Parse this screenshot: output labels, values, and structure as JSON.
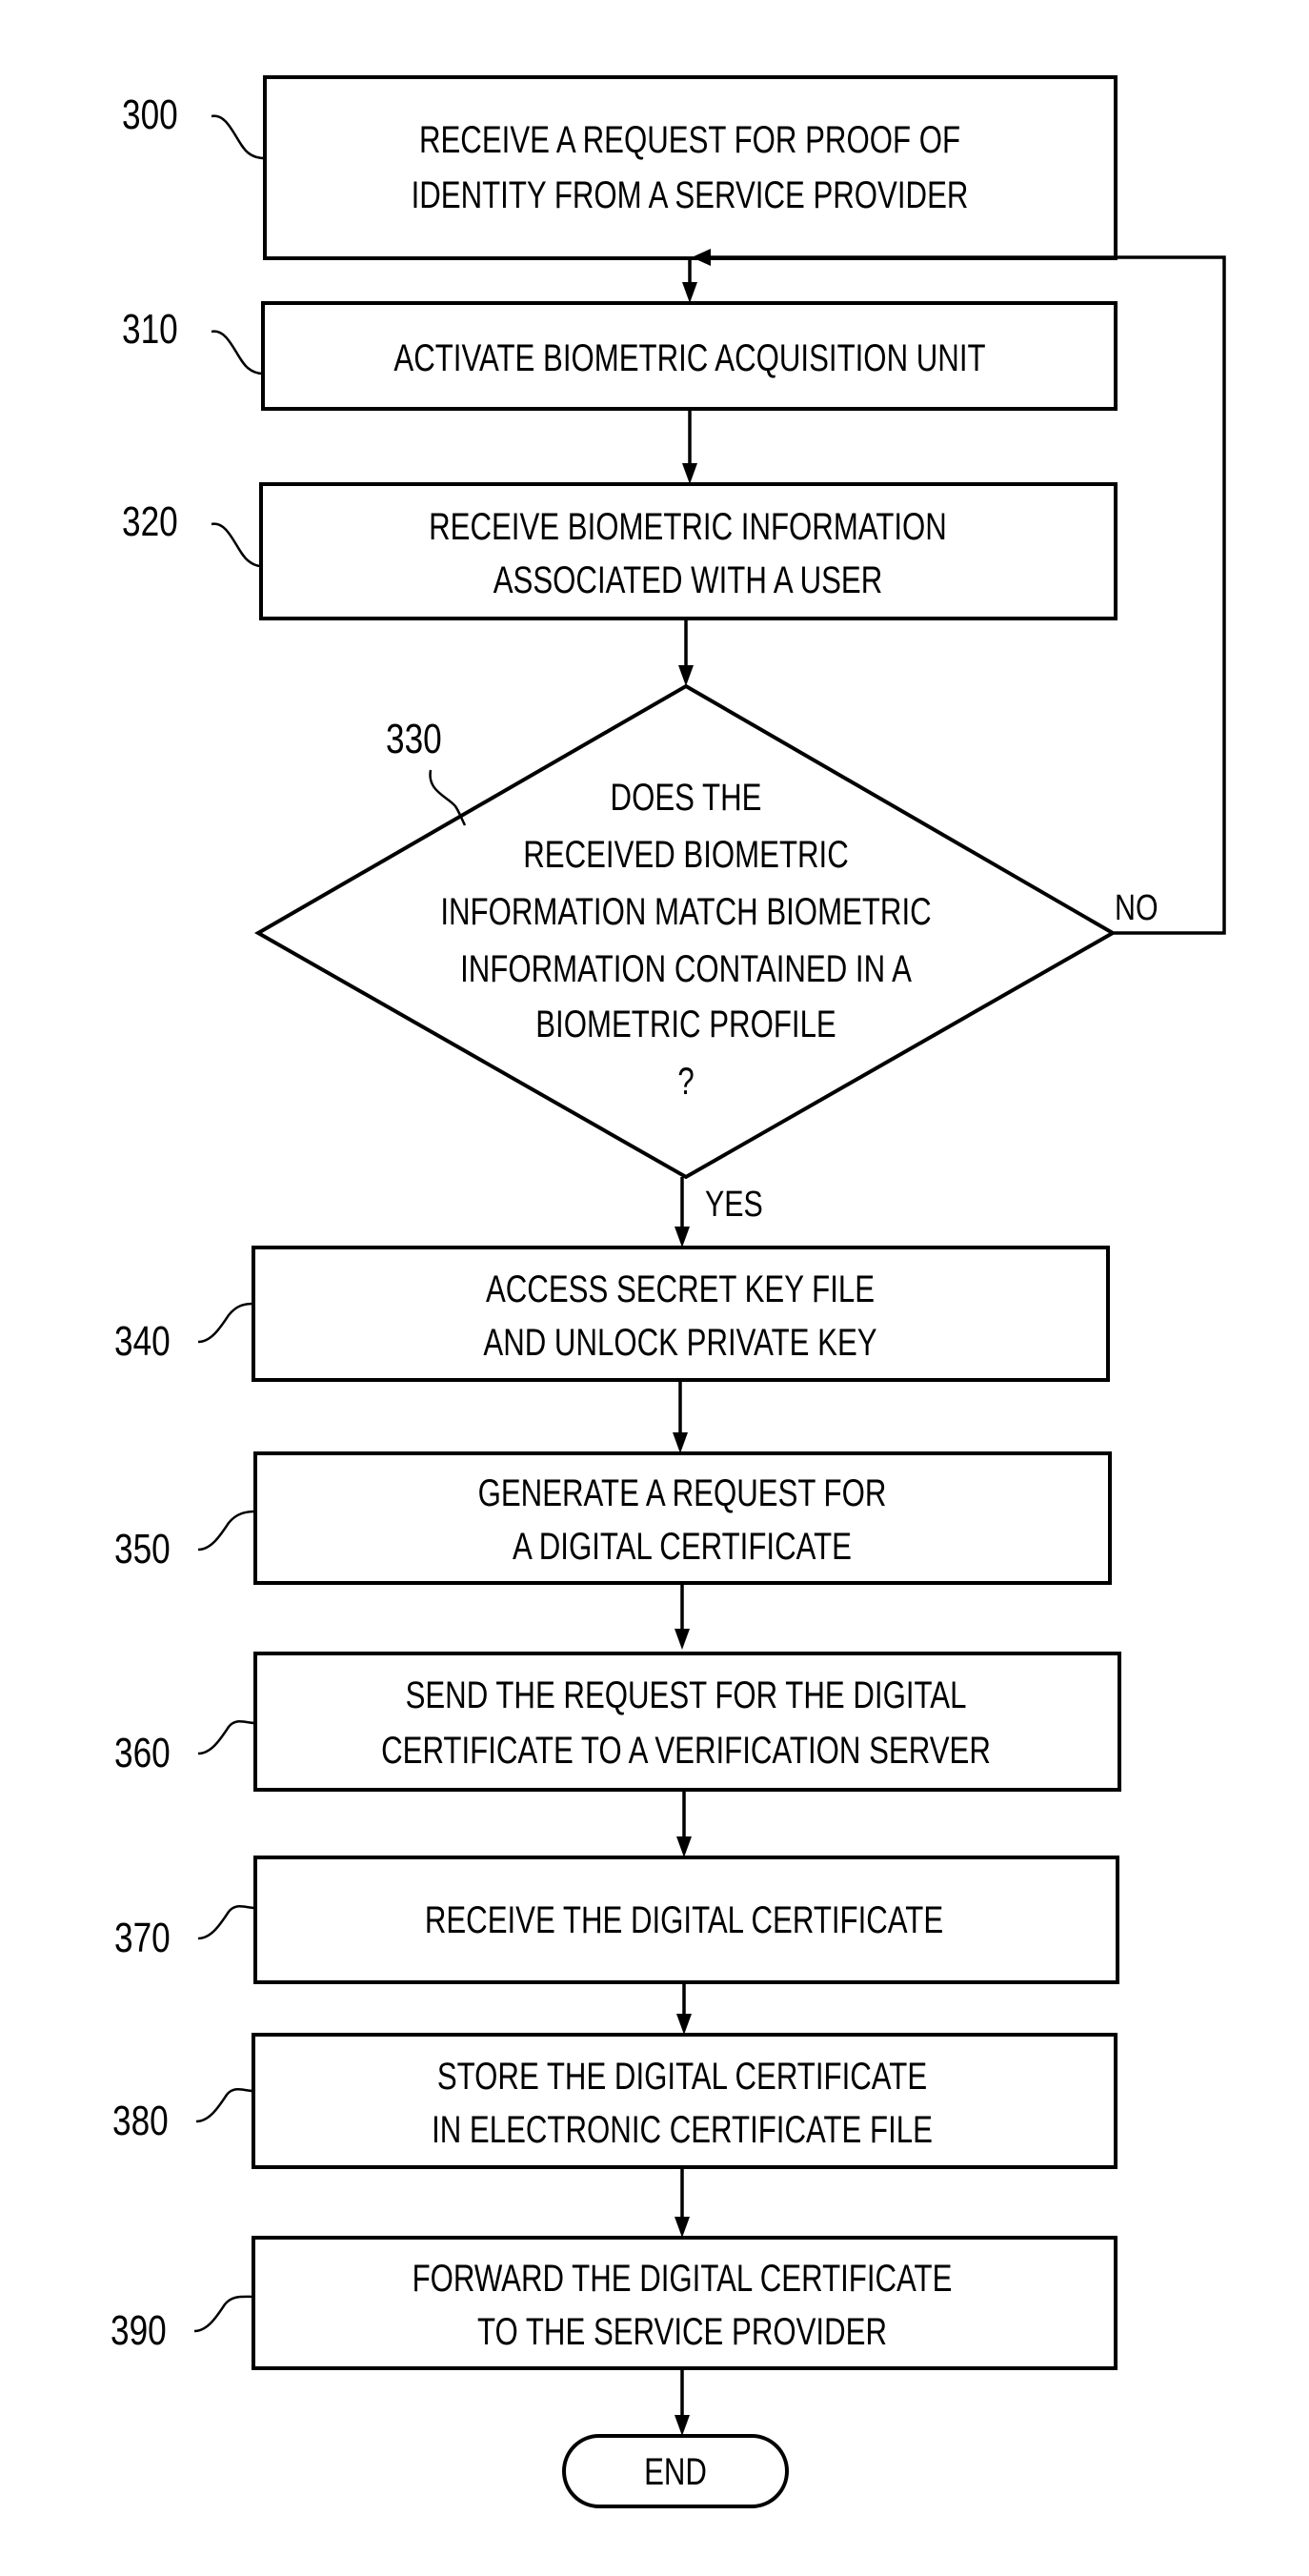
{
  "diagram": {
    "type": "flowchart",
    "steps": [
      {
        "ref": "300",
        "lines": [
          "RECEIVE A REQUEST FOR PROOF OF",
          "IDENTITY FROM A SERVICE PROVIDER"
        ]
      },
      {
        "ref": "310",
        "lines": [
          "ACTIVATE BIOMETRIC ACQUISITION UNIT"
        ]
      },
      {
        "ref": "320",
        "lines": [
          "RECEIVE BIOMETRIC INFORMATION",
          "ASSOCIATED WITH A USER"
        ]
      },
      {
        "ref": "330",
        "lines": [
          "DOES THE",
          "RECEIVED BIOMETRIC",
          "INFORMATION MATCH BIOMETRIC",
          "INFORMATION CONTAINED IN A",
          "BIOMETRIC PROFILE",
          "?"
        ]
      },
      {
        "ref": "340",
        "lines": [
          "ACCESS SECRET KEY FILE",
          "AND UNLOCK PRIVATE KEY"
        ]
      },
      {
        "ref": "350",
        "lines": [
          "GENERATE A REQUEST FOR",
          "A DIGITAL CERTIFICATE"
        ]
      },
      {
        "ref": "360",
        "lines": [
          "SEND THE REQUEST FOR THE DIGITAL",
          "CERTIFICATE TO A VERIFICATION SERVER"
        ]
      },
      {
        "ref": "370",
        "lines": [
          "RECEIVE THE DIGITAL CERTIFICATE"
        ]
      },
      {
        "ref": "380",
        "lines": [
          "STORE THE DIGITAL CERTIFICATE",
          "IN ELECTRONIC CERTIFICATE FILE"
        ]
      },
      {
        "ref": "390",
        "lines": [
          "FORWARD THE DIGITAL CERTIFICATE",
          "TO THE SERVICE PROVIDER"
        ]
      }
    ],
    "decision_labels": {
      "no": "NO",
      "yes": "YES"
    },
    "end_label": "END"
  }
}
